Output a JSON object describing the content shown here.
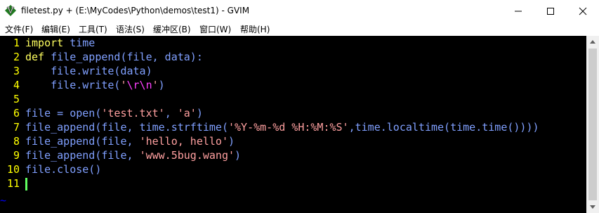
{
  "window": {
    "title": "filetest.py + (E:\\MyCodes\\Python\\demos\\test1) - GVIM",
    "icon": "gvim-icon"
  },
  "menubar": {
    "items": [
      "文件(F)",
      "编辑(E)",
      "工具(T)",
      "语法(S)",
      "缓冲区(B)",
      "窗口(W)",
      "帮助(H)"
    ]
  },
  "editor": {
    "line_numbers": [
      "1",
      "2",
      "3",
      "4",
      "5",
      "6",
      "7",
      "8",
      "9",
      "10",
      "11"
    ],
    "lines": [
      [
        {
          "t": "import",
          "c": "kw"
        },
        {
          "t": " time",
          "c": ""
        }
      ],
      [
        {
          "t": "def",
          "c": "kw"
        },
        {
          "t": " file_append(file, data):",
          "c": ""
        }
      ],
      [
        {
          "t": "    file.write(data)",
          "c": ""
        }
      ],
      [
        {
          "t": "    file.write(",
          "c": ""
        },
        {
          "t": "'",
          "c": "str"
        },
        {
          "t": "\\r\\n",
          "c": "esc"
        },
        {
          "t": "'",
          "c": "str"
        },
        {
          "t": ")",
          "c": ""
        }
      ],
      [],
      [
        {
          "t": "file = open(",
          "c": ""
        },
        {
          "t": "'test.txt'",
          "c": "str"
        },
        {
          "t": ", ",
          "c": ""
        },
        {
          "t": "'a'",
          "c": "str"
        },
        {
          "t": ")",
          "c": ""
        }
      ],
      [
        {
          "t": "file_append(file, time.strftime(",
          "c": ""
        },
        {
          "t": "'%Y-%m-%d %H:%M:%S'",
          "c": "str"
        },
        {
          "t": ",time.localtime(time.time())))",
          "c": ""
        }
      ],
      [
        {
          "t": "file_append(file, ",
          "c": ""
        },
        {
          "t": "'hello, hello'",
          "c": "str"
        },
        {
          "t": ")",
          "c": ""
        }
      ],
      [
        {
          "t": "file_append(file, ",
          "c": ""
        },
        {
          "t": "'www.5bug.wang'",
          "c": "str"
        },
        {
          "t": ")",
          "c": ""
        }
      ],
      [
        {
          "t": "file.close()",
          "c": ""
        }
      ],
      []
    ],
    "empty_marker": "~"
  }
}
